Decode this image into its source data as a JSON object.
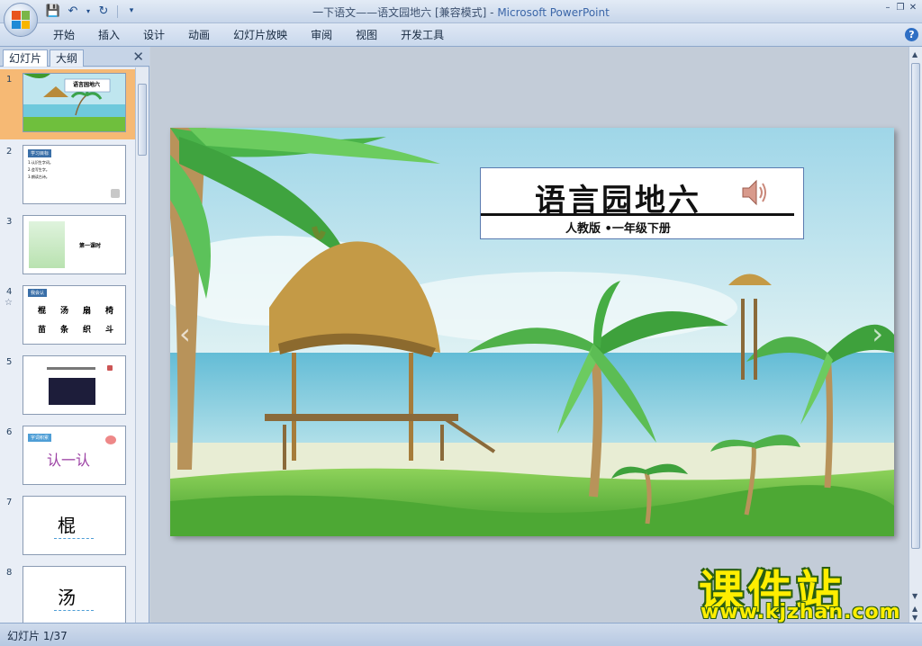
{
  "window": {
    "title_doc": "一下语文——语文园地六 [兼容模式] - ",
    "title_app": "Microsoft PowerPoint"
  },
  "ribbon": {
    "tabs": [
      "开始",
      "插入",
      "设计",
      "动画",
      "幻灯片放映",
      "审阅",
      "视图",
      "开发工具"
    ]
  },
  "panel": {
    "tab_slides": "幻灯片",
    "tab_outline": "大纲",
    "thumbnails": [
      {
        "num": "1",
        "title": "语言园地六"
      },
      {
        "num": "2",
        "title": "",
        "label": "学习目标",
        "lines": [
          "1.认识生字词。",
          "2.会写生字。",
          "3.朗读古诗。"
        ]
      },
      {
        "num": "3",
        "title": "第一课时"
      },
      {
        "num": "4",
        "label": "我会认",
        "chars": [
          "棍",
          "汤",
          "扇",
          "椅",
          "苗",
          "条",
          "织",
          "斗"
        ]
      },
      {
        "num": "5",
        "title": ""
      },
      {
        "num": "6",
        "title": "认一认",
        "label": "字词积累"
      },
      {
        "num": "7",
        "title": "棍"
      },
      {
        "num": "8",
        "title": "汤"
      }
    ]
  },
  "slide": {
    "title": "语言园地六",
    "subtitle": "人教版 •一年级下册"
  },
  "status": {
    "slide_count": "幻灯片 1/37"
  },
  "watermark": {
    "cn": "课件站",
    "url": "www.kjzhan.com"
  },
  "colors": {
    "ribbon": "#c9d8ec",
    "selected_thumb": "#f6b974",
    "watermark_yellow": "#ffee00"
  }
}
